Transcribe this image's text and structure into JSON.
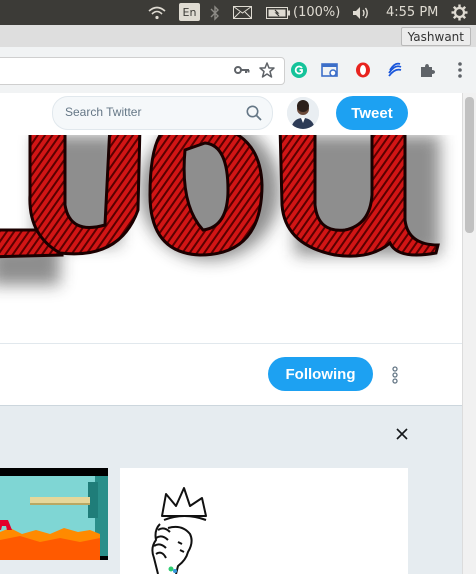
{
  "system_bar": {
    "keyboard_layout": "En",
    "battery_label": "(100%)",
    "clock": "4:55 PM",
    "icons": [
      "wifi-icon",
      "bluetooth-icon",
      "mail-icon",
      "battery-icon",
      "volume-icon",
      "power-gear-icon"
    ]
  },
  "browser": {
    "profile_name": "Yashwant",
    "toolbar_icons": [
      "key-icon",
      "star-icon",
      "grammarly-icon",
      "screen-capture-icon",
      "opera-icon",
      "lines-extension-icon",
      "puzzle-icon",
      "menu-dots-icon"
    ]
  },
  "twitter": {
    "search_placeholder": "Search Twitter",
    "tweet_label": "Tweet",
    "following_label": "Following",
    "accent_color": "#1da1f2"
  }
}
